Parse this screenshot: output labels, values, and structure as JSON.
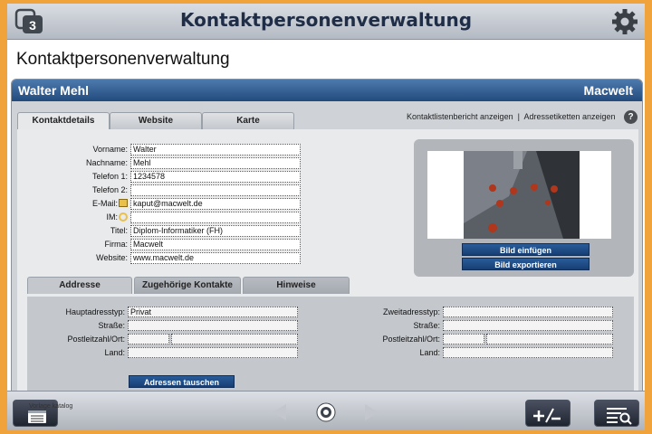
{
  "app": {
    "title": "Kontaktpersonenverwaltung",
    "pages_badge": "3"
  },
  "page": {
    "title": "Kontaktpersonenverwaltung"
  },
  "contact": {
    "name": "Walter Mehl",
    "company": "Macwelt"
  },
  "tabs": [
    {
      "label": "Kontaktdetails",
      "active": true
    },
    {
      "label": "Website",
      "active": false
    },
    {
      "label": "Karte",
      "active": false
    }
  ],
  "links": {
    "report": "Kontaktlistenbericht anzeigen",
    "separator": "|",
    "labels": "Adressetiketten anzeigen",
    "help": "?"
  },
  "fields": [
    {
      "label": "Vorname:",
      "value": "Walter"
    },
    {
      "label": "Nachname:",
      "value": "Mehl"
    },
    {
      "label": "Telefon 1:",
      "value": "1234578"
    },
    {
      "label": "Telefon 2:",
      "value": ""
    },
    {
      "label": "E-Mail:",
      "value": "kaput@macwelt.de"
    },
    {
      "label": "IM:",
      "value": ""
    },
    {
      "label": "Titel:",
      "value": "Diplom-Informatiker (FH)"
    },
    {
      "label": "Firma:",
      "value": "Macwelt"
    },
    {
      "label": "Website:",
      "value": "www.macwelt.de"
    }
  ],
  "photo_buttons": {
    "insert": "Bild einfügen",
    "export": "Bild exportieren"
  },
  "sub_tabs": [
    {
      "label": "Addresse",
      "active": true
    },
    {
      "label": "Zugehörige Kontakte",
      "active": false
    },
    {
      "label": "Hinweise",
      "active": false
    }
  ],
  "address_left": {
    "type_label": "Hauptadresstyp:",
    "type_value": "Privat",
    "street_label": "Straße:",
    "street_value": "",
    "zip_label": "Postleitzahl/Ort:",
    "zip_value": "",
    "city_value": "",
    "country_label": "Land:",
    "country_value": ""
  },
  "address_right": {
    "type_label": "Zweitadresstyp:",
    "type_value": "",
    "street_label": "Straße:",
    "street_value": "",
    "zip_label": "Postleitzahl/Ort:",
    "zip_value": "",
    "city_value": "",
    "country_label": "Land:",
    "country_value": ""
  },
  "swap_button": "Adressen tauschen",
  "bottom": {
    "vorlage_text": "Vorlage katalog"
  },
  "colors": {
    "accent": "#224a7d",
    "frame": "#f0a33a"
  }
}
